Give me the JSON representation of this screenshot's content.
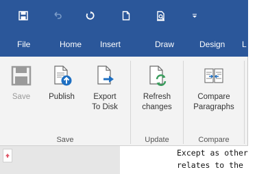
{
  "colors": {
    "brand": "#2b579a",
    "accent_blue": "#1e6fc2",
    "accent_green": "#3a9d5d"
  },
  "quick_access": {
    "save": "save-icon",
    "undo": "undo-icon",
    "redo": "redo-icon",
    "new": "new-document-icon",
    "print_preview": "print-preview-icon",
    "customize": "customize-qat-icon"
  },
  "tabs": [
    {
      "label": "File"
    },
    {
      "label": "Home"
    },
    {
      "label": "Insert"
    },
    {
      "label": "Draw"
    },
    {
      "label": "Design"
    },
    {
      "label": "L"
    }
  ],
  "ribbon": {
    "groups": [
      {
        "label": "Save",
        "buttons": [
          {
            "label": "Save",
            "icon": "save-icon",
            "disabled": true
          },
          {
            "label": "Publish",
            "icon": "publish-icon"
          },
          {
            "label_line1": "Export",
            "label_line2": "To Disk",
            "icon": "export-icon"
          }
        ]
      },
      {
        "label": "Update",
        "buttons": [
          {
            "label_line1": "Refresh",
            "label_line2": "changes",
            "icon": "refresh-icon"
          }
        ]
      },
      {
        "label": "Compare",
        "buttons": [
          {
            "label_line1": "Compare",
            "label_line2": "Paragraphs",
            "icon": "compare-icon"
          }
        ]
      }
    ]
  },
  "document": {
    "lines": [
      "Except as otherwi",
      "relates to the \"su"
    ]
  }
}
